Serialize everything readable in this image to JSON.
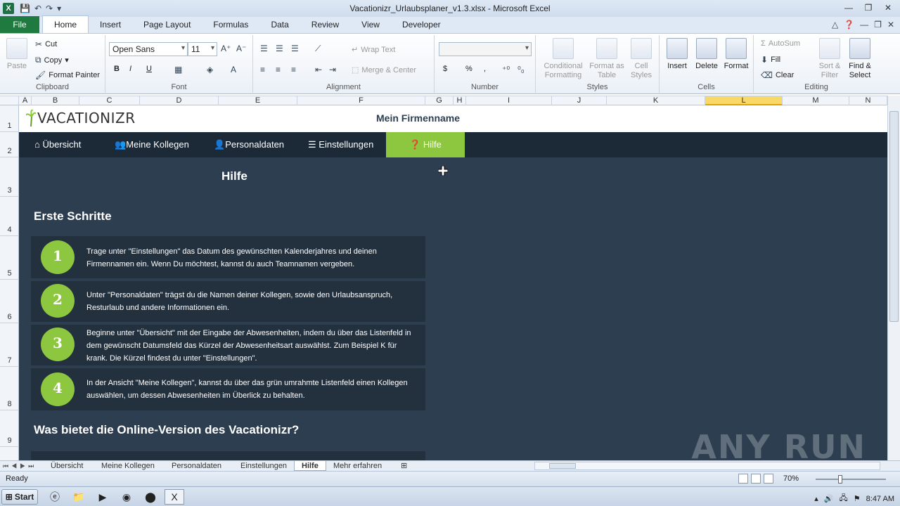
{
  "window": {
    "title": "Vacationizr_Urlaubsplaner_v1.3.xlsx - Microsoft Excel",
    "app_icon": "X",
    "controls": [
      "minimize",
      "restore",
      "close"
    ]
  },
  "ribbon_tabs": [
    "File",
    "Home",
    "Insert",
    "Page Layout",
    "Formulas",
    "Data",
    "Review",
    "View",
    "Developer"
  ],
  "active_tab": "Home",
  "ribbon": {
    "clipboard": {
      "paste": "Paste",
      "cut": "Cut",
      "copy": "Copy",
      "format_painter": "Format Painter",
      "label": "Clipboard"
    },
    "font": {
      "name": "Open Sans",
      "size": "11",
      "label": "Font",
      "bold": "B",
      "italic": "I",
      "underline": "U"
    },
    "alignment": {
      "wrap": "Wrap Text",
      "merge": "Merge & Center",
      "label": "Alignment"
    },
    "number": {
      "label": "Number",
      "currency": "$",
      "percent": "%",
      "comma": ","
    },
    "styles": {
      "conditional": "Conditional Formatting",
      "format_table": "Format as Table",
      "cell_styles": "Cell Styles",
      "label": "Styles"
    },
    "cells": {
      "insert": "Insert",
      "delete": "Delete",
      "format": "Format",
      "label": "Cells"
    },
    "editing": {
      "autosum": "AutoSum",
      "fill": "Fill",
      "clear": "Clear",
      "sort": "Sort & Filter",
      "find": "Find & Select",
      "label": "Editing"
    }
  },
  "columns": [
    "A",
    "B",
    "C",
    "D",
    "E",
    "F",
    "G",
    "H",
    "I",
    "J",
    "K",
    "L",
    "M",
    "N"
  ],
  "selected_column": "L",
  "rows": [
    "1",
    "2",
    "3",
    "4",
    "5",
    "6",
    "7",
    "8",
    "9"
  ],
  "sheet": {
    "logo": "VACATIONIZR",
    "company": "Mein Firmenname",
    "nav": [
      {
        "icon": "home-icon",
        "label": "Übersicht"
      },
      {
        "icon": "users-icon",
        "label": "Meine Kollegen"
      },
      {
        "icon": "user-icon",
        "label": "Personaldaten"
      },
      {
        "icon": "sliders-icon",
        "label": "Einstellungen"
      },
      {
        "icon": "question-icon",
        "label": "Hilfe"
      }
    ],
    "page_title": "Hilfe",
    "section1": "Erste Schritte",
    "steps": [
      {
        "num": "1",
        "text": "Trage unter \"Einstellungen\" das Datum des gewünschten Kalenderjahres und deinen Firmennamen ein. Wenn Du möchtest, kannst du auch Teamnamen vergeben."
      },
      {
        "num": "2",
        "text": "Unter \"Personaldaten\" trägst du die Namen deiner Kollegen, sowie den Urlaubsanspruch, Resturlaub und andere Informationen ein."
      },
      {
        "num": "3",
        "text": "Beginne unter \"Übersicht\" mit der Eingabe der Abwesenheiten, indem du über das Listenfeld in dem gewünscht Datumsfeld das Kürzel der Abwesenheitsart auswählst. Zum Beispiel K für krank. Die Kürzel findest du unter \"Einstellungen\"."
      },
      {
        "num": "4",
        "text": "In der Ansicht \"Meine Kollegen\", kannst du über das grün umrahmte Listenfeld einen Kollegen auswählen, um dessen Abwesenheiten im Überlick zu behalten."
      }
    ],
    "section2": "Was bietet die Online-Version des Vacationizr?",
    "watermark": "ANY RUN"
  },
  "sheet_tabs": [
    "Übersicht",
    "Meine Kollegen",
    "Personaldaten",
    "Einstellungen",
    "Hilfe",
    "Mehr erfahren"
  ],
  "active_sheet": "Hilfe",
  "status": {
    "ready": "Ready",
    "zoom": "70%"
  },
  "taskbar": {
    "start": "Start",
    "time": "8:47 AM"
  },
  "colors": {
    "accent_green": "#8dc63f",
    "navbar": "#1c2a37",
    "sheet_bg": "#2d3e50",
    "excel_green": "#1f7a40"
  }
}
